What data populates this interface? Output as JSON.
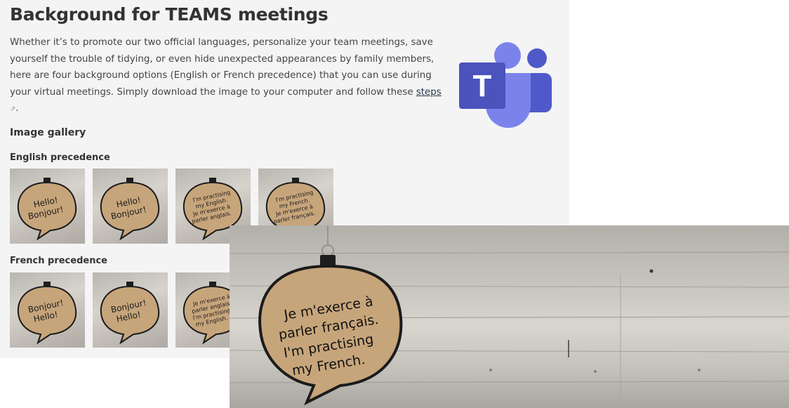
{
  "header": {
    "title": "Background for TEAMS meetings"
  },
  "intro": {
    "text": "Whether it’s to promote our two official languages, personalize your team meetings, save yourself the trouble of tidying, or even hide unexpected appearances by family members, here are four background options (English or French precedence) that you can use during your virtual meetings. Simply download the image to your computer and follow these ",
    "link_label": "steps",
    "link_icon": "external-link-icon",
    "trailing": "."
  },
  "gallery": {
    "heading": "Image gallery",
    "english": {
      "heading": "English precedence",
      "thumbs": [
        {
          "lines": [
            "Hello!",
            "Bonjour!"
          ]
        },
        {
          "lines": [
            "Hello!",
            "Bonjour!"
          ]
        },
        {
          "lines": [
            "I'm practising",
            "my English.",
            "Je m'exerce à",
            "parler anglais."
          ]
        },
        {
          "lines": [
            "I'm practising",
            "my French.",
            "Je m'exerce à",
            "parler français."
          ]
        }
      ]
    },
    "french": {
      "heading": "French precedence",
      "thumbs": [
        {
          "lines": [
            "Bonjour!",
            "Hello!"
          ]
        },
        {
          "lines": [
            "Bonjour!",
            "Hello!"
          ]
        },
        {
          "lines": [
            "Je m'exerce à",
            "parler anglais.",
            "I'm practising",
            "my English."
          ]
        }
      ]
    }
  },
  "preview": {
    "lines": [
      "Je m'exerce à",
      "parler français.",
      "I'm practising",
      "my French."
    ]
  },
  "logo": {
    "name": "teams-logo",
    "letter": "T",
    "colors": {
      "dark": "#4b53bc",
      "light": "#7b83eb",
      "mid": "#5059c9"
    }
  }
}
